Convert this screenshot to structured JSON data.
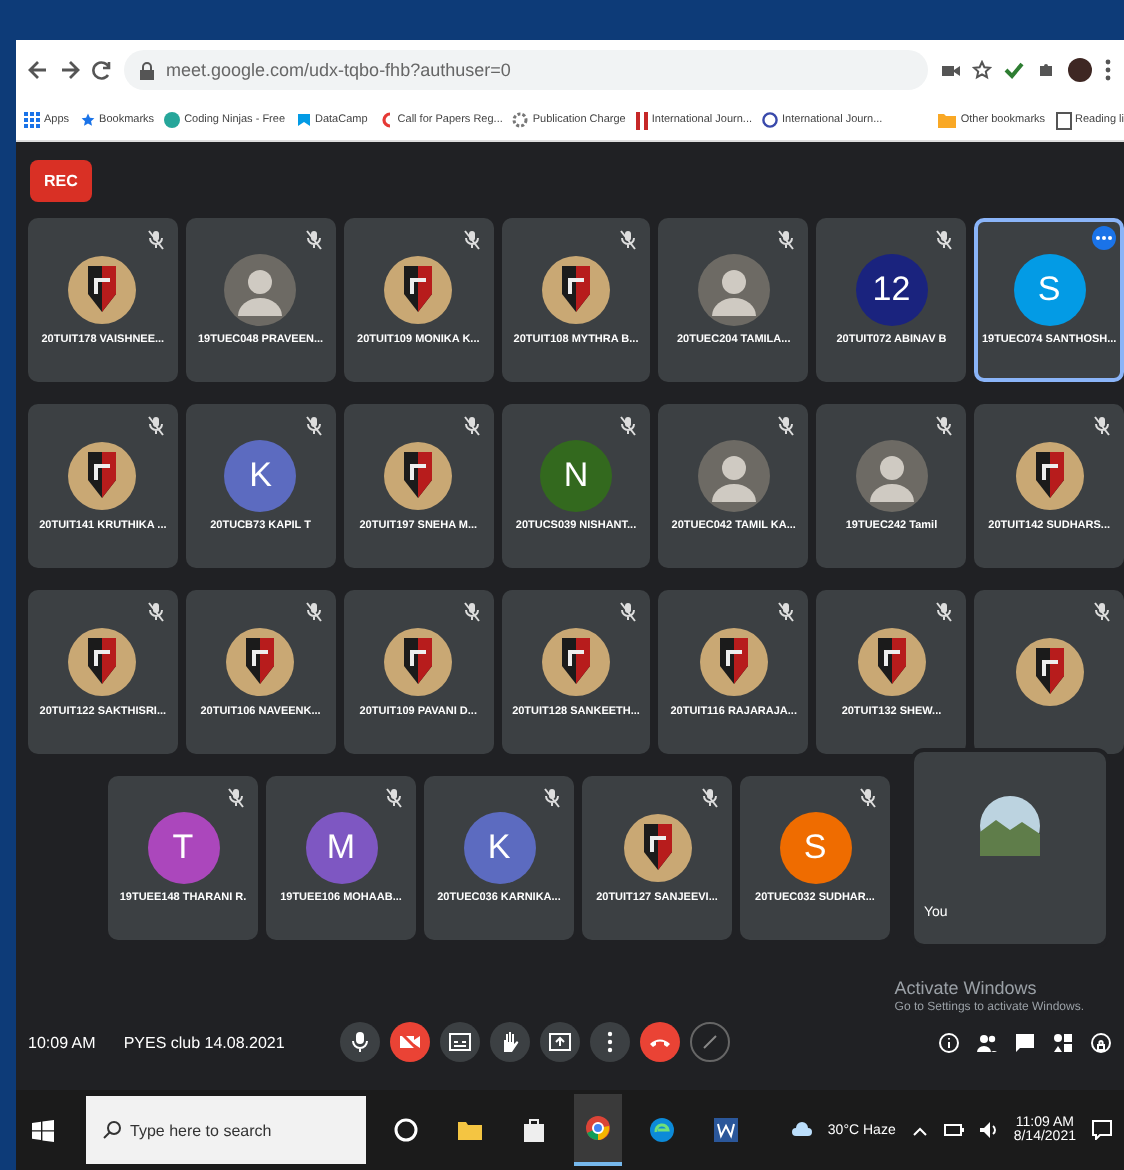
{
  "browser": {
    "url": "meet.google.com/udx-tqbo-fhb?authuser=0",
    "bookmarks": [
      {
        "label": "Apps"
      },
      {
        "label": "Bookmarks"
      },
      {
        "label": "Coding Ninjas - Free"
      },
      {
        "label": "DataCamp"
      },
      {
        "label": "Call for Papers Reg..."
      },
      {
        "label": "Publication Charge"
      },
      {
        "label": "International Journ..."
      },
      {
        "label": "International Journ..."
      }
    ],
    "other_bookmarks": "Other bookmarks",
    "reading_list": "Reading li"
  },
  "meeting": {
    "recording": "REC",
    "grid_rows": [
      [
        {
          "name": "20TUIT178 VAISHNEE...",
          "kind": "logo",
          "muted": true,
          "highlighted": false
        },
        {
          "name": "19TUEC048 PRAVEEN...",
          "kind": "photo",
          "muted": true,
          "highlighted": false
        },
        {
          "name": "20TUIT109 MONIKA K...",
          "kind": "logo",
          "muted": true,
          "highlighted": false
        },
        {
          "name": "20TUIT108 MYTHRA B...",
          "kind": "logo",
          "muted": true,
          "highlighted": false
        },
        {
          "name": "20TUEC204 TAMILA...",
          "kind": "photo",
          "muted": true,
          "highlighted": false
        },
        {
          "name": "20TUIT072 ABINAV B",
          "kind": "letter",
          "letter": "12",
          "color": "#1a237e",
          "muted": true,
          "highlighted": false
        },
        {
          "name": "19TUEC074 SANTHOSH...",
          "kind": "letter",
          "letter": "S",
          "color": "#039be5",
          "muted": false,
          "highlighted": true
        }
      ],
      [
        {
          "name": "20TUIT141 KRUTHIKA ...",
          "kind": "logo",
          "muted": true,
          "highlighted": false
        },
        {
          "name": "20TUCB73 KAPIL T",
          "kind": "letter",
          "letter": "K",
          "color": "#5c6bc0",
          "muted": true,
          "highlighted": false
        },
        {
          "name": "20TUIT197 SNEHA M...",
          "kind": "logo",
          "muted": true,
          "highlighted": false
        },
        {
          "name": "20TUCS039 NISHANT...",
          "kind": "letter",
          "letter": "N",
          "color": "#33691e",
          "muted": true,
          "highlighted": false
        },
        {
          "name": "20TUEC042 TAMIL KA...",
          "kind": "photo",
          "muted": true,
          "highlighted": false
        },
        {
          "name": "19TUEC242 Tamil",
          "kind": "photo",
          "muted": true,
          "highlighted": false
        },
        {
          "name": "20TUIT142 SUDHARS...",
          "kind": "logo",
          "muted": true,
          "highlighted": false
        }
      ],
      [
        {
          "name": "20TUIT122 SAKTHISRI...",
          "kind": "logo",
          "muted": true,
          "highlighted": false
        },
        {
          "name": "20TUIT106 NAVEENK...",
          "kind": "logo",
          "muted": true,
          "highlighted": false
        },
        {
          "name": "20TUIT109 PAVANI D...",
          "kind": "logo",
          "muted": true,
          "highlighted": false
        },
        {
          "name": "20TUIT128 SANKEETH...",
          "kind": "logo",
          "muted": true,
          "highlighted": false
        },
        {
          "name": "20TUIT116 RAJARAJA...",
          "kind": "logo",
          "muted": true,
          "highlighted": false
        },
        {
          "name": "20TUIT132 SHEW...",
          "kind": "logo",
          "muted": true,
          "highlighted": false
        },
        {
          "kind": "logo",
          "muted": true,
          "highlighted": false
        }
      ],
      [
        {
          "name": "19TUEE148 THARANI R.",
          "kind": "letter",
          "letter": "T",
          "color": "#ab47bc",
          "muted": true,
          "highlighted": false
        },
        {
          "name": "19TUEE106 MOHAAB...",
          "kind": "letter",
          "letter": "M",
          "color": "#7e57c2",
          "muted": true,
          "highlighted": false
        },
        {
          "name": "20TUEC036 KARNIKA...",
          "kind": "letter",
          "letter": "K",
          "color": "#5c6bc0",
          "muted": true,
          "highlighted": false
        },
        {
          "name": "20TUIT127 SANJEEVI...",
          "kind": "logo",
          "muted": true,
          "highlighted": false
        },
        {
          "name": "20TUEC032 SUDHAR...",
          "kind": "letter",
          "letter": "S",
          "color": "#ef6c00",
          "muted": true,
          "highlighted": false
        }
      ]
    ],
    "self_view": {
      "label": "You"
    },
    "time": "10:09 AM",
    "title": "PYES club 14.08.2021",
    "controls": [
      {
        "kind": "mic",
        "off": false
      },
      {
        "kind": "camera",
        "off": true
      },
      {
        "kind": "captions",
        "off": false
      },
      {
        "kind": "hand",
        "off": false
      },
      {
        "kind": "present",
        "off": false
      },
      {
        "kind": "more",
        "off": false
      },
      {
        "kind": "end",
        "off": true
      },
      {
        "kind": "pen"
      }
    ],
    "side_controls": [
      {
        "kind": "info"
      },
      {
        "kind": "people"
      },
      {
        "kind": "chat"
      },
      {
        "kind": "activities"
      },
      {
        "kind": "lock"
      }
    ]
  },
  "activation": {
    "title": "Activate Windows",
    "text": "Go to Settings to activate Windows."
  },
  "taskbar": {
    "search_placeholder": "Type here to search",
    "apps": [
      {
        "kind": "cortana",
        "selected": false
      },
      {
        "kind": "folder",
        "selected": false
      },
      {
        "kind": "store",
        "selected": false
      },
      {
        "kind": "chrome",
        "selected": true
      },
      {
        "kind": "edge",
        "selected": false
      },
      {
        "kind": "word",
        "selected": false
      }
    ],
    "weather": "30°C Haze",
    "time": "11:09 AM",
    "date": "8/14/2021"
  }
}
